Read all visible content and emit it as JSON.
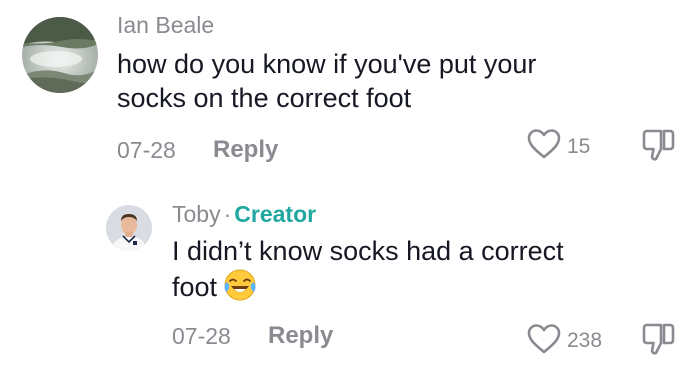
{
  "comment": {
    "username": "Ian Beale",
    "text_lines": [
      "how do you know if you've put your",
      "socks on the correct foot"
    ],
    "date": "07-28",
    "reply_label": "Reply",
    "like_count": "15"
  },
  "reply": {
    "username": "Toby",
    "separator": "·",
    "badge": "Creator",
    "text_lines": [
      "I didn’t know socks had a correct",
      "foot"
    ],
    "emoji": "face-with-tears-of-joy",
    "date": "07-28",
    "reply_label": "Reply",
    "like_count": "238"
  },
  "colors": {
    "muted_text": "#8a8b91",
    "creator_badge": "#20a7a0",
    "body_text": "#161823"
  },
  "icons": [
    "heart-outline-icon",
    "thumbs-down-outline-icon"
  ]
}
